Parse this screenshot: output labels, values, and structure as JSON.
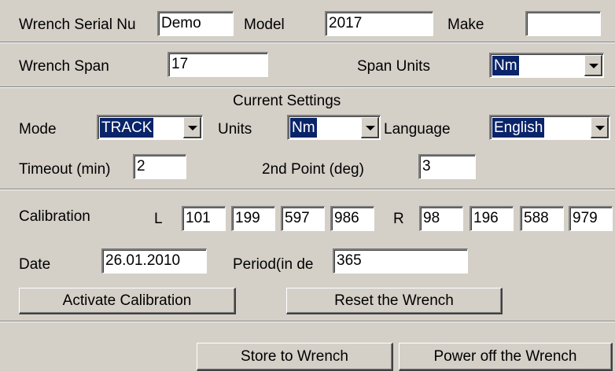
{
  "wrench": {
    "serial_label": "Wrench Serial Nu",
    "serial_value": "Demo",
    "model_label": "Model",
    "model_value": "2017",
    "make_label": "Make",
    "make_value": "",
    "span_label": "Wrench Span",
    "span_value": "17",
    "span_units_label": "Span Units",
    "span_units_value": "Nm"
  },
  "settings": {
    "title": "Current Settings",
    "mode_label": "Mode",
    "mode_value": "TRACK",
    "units_label": "Units",
    "units_value": "Nm",
    "language_label": "Language",
    "language_value": "English",
    "timeout_label": "Timeout (min)",
    "timeout_value": "2",
    "second_point_label": "2nd Point (deg)",
    "second_point_value": "3"
  },
  "calibration": {
    "label": "Calibration",
    "left_label": "L",
    "left_values": [
      "101",
      "199",
      "597",
      "986"
    ],
    "right_label": "R",
    "right_values": [
      "98",
      "196",
      "588",
      "979"
    ],
    "date_label": "Date",
    "date_value": "26.01.2010",
    "period_label": "Period(in de",
    "period_value": "365",
    "activate_button": "Activate Calibration",
    "reset_button": "Reset the Wrench"
  },
  "actions": {
    "store_button": "Store to Wrench",
    "power_off_button": "Power off the Wrench"
  }
}
